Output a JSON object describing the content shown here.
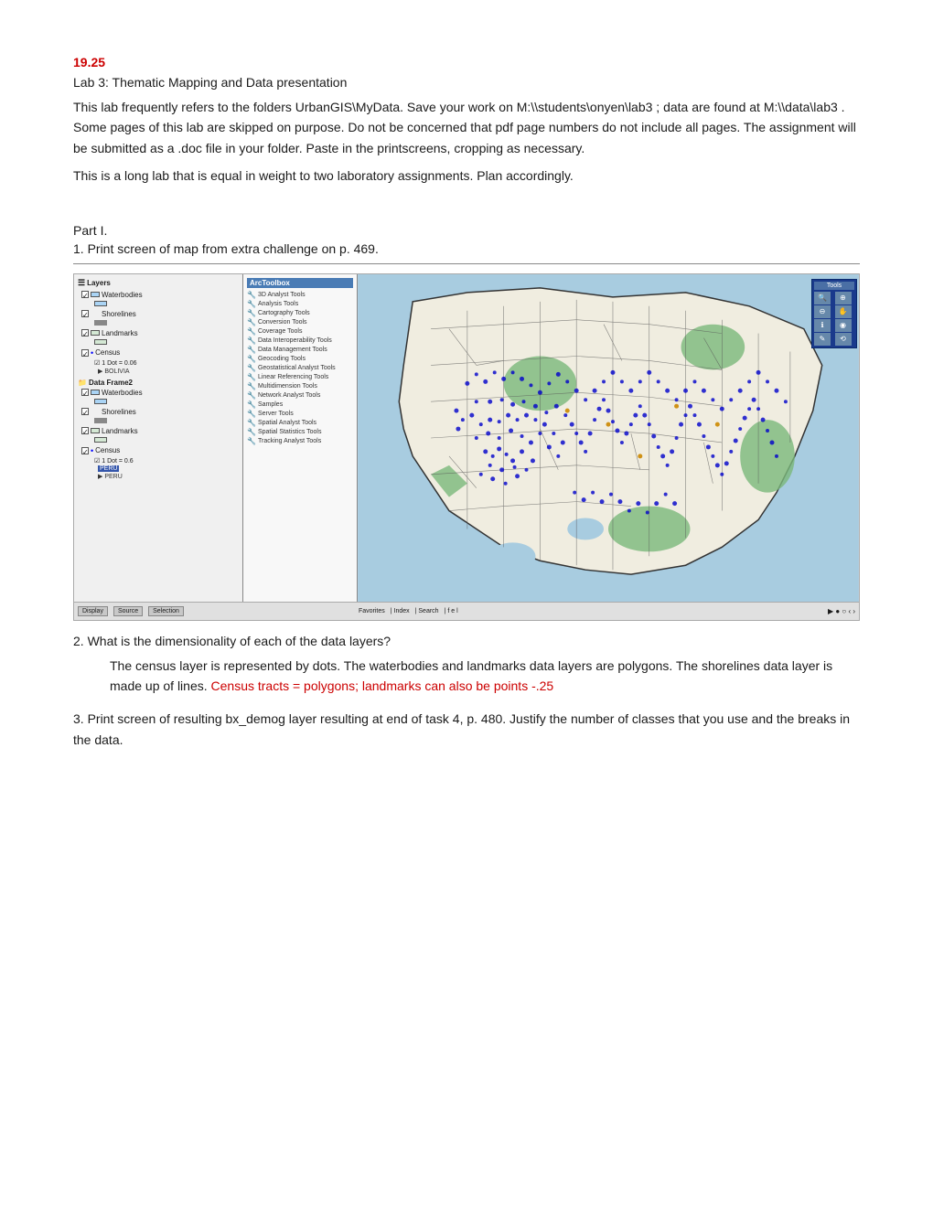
{
  "page": {
    "number": "19.25",
    "lab_title": "Lab 3: Thematic Mapping and Data presentation",
    "intro_paragraphs": [
      "This lab frequently refers to the folders UrbanGIS\\MyData. Save your work on M:\\\\students\\onyen\\lab3 ; data are found at M:\\\\data\\lab3 . Some pages of this lab are skipped on purpose. Do not be concerned that pdf page numbers do not include all pages. The assignment will be submitted as a .doc file in your folder. Paste in the printscreens, cropping as necessary.",
      "This is a long lab that is equal in weight to two laboratory assignments. Plan accordingly."
    ],
    "part_i": {
      "label": "Part I.",
      "question_1": {
        "label": "1. Print screen of map from extra challenge on p. 469."
      },
      "question_2": {
        "label": "2. What is the dimensionality of each of the data layers?",
        "answer_plain": "The census layer is represented by dots. The waterbodies and landmarks data layers are polygons. The shorelines data layer is made up of lines.",
        "answer_red": "Census tracts = polygons; landmarks can also be points  -.25"
      },
      "question_3": {
        "label": "3. Print screen of resulting bx_demog layer resulting at end of task 4, p. 480. Justify the number of classes that you use and the breaks in the data."
      }
    },
    "gis_screenshot": {
      "left_panel": {
        "header": "Layers",
        "items": [
          {
            "name": "Waterbodies",
            "checked": true,
            "type": "polygon"
          },
          {
            "name": "Shorelines",
            "checked": true,
            "type": "line"
          },
          {
            "name": "Landmarks",
            "checked": true,
            "type": "polygon"
          },
          {
            "name": "Census",
            "checked": true,
            "type": "dot",
            "note": "1 Dot = 0.06",
            "sublabel": "BOLIVIA"
          }
        ],
        "dataframe2": {
          "label": "Data Frame2",
          "items": [
            {
              "name": "Waterbodies",
              "checked": true,
              "type": "polygon"
            },
            {
              "name": "Shorelines",
              "checked": true,
              "type": "line"
            },
            {
              "name": "Landmarks",
              "checked": true,
              "type": "polygon"
            },
            {
              "name": "Census",
              "checked": true,
              "type": "dot",
              "note": "1 Dot = 0.6",
              "sublabel": "PERU"
            }
          ]
        }
      },
      "middle_panel": {
        "header": "ArcToolbox",
        "tools": [
          "3D Analyst Tools",
          "Analysis Tools",
          "Cartography Tools",
          "Conversion Tools",
          "Coverage Tools",
          "Data Interoperability Tools",
          "Data Management Tools",
          "Geocoding Tools",
          "Geostatistical Analyst Tools",
          "Linear Referencing Tools",
          "Multidimension Tools",
          "Network Analyst Tools",
          "Samples",
          "Server Tools",
          "Spatial Analyst Tools",
          "Spatial Statistics Tools",
          "Tracking Analyst Tools"
        ]
      },
      "bottom_tabs": [
        "Display",
        "Source",
        "Selection",
        "Favorites",
        "Index",
        "Search",
        "f e l"
      ],
      "tools_right": {
        "buttons": [
          "zoom_in",
          "zoom_out",
          "pan",
          "identify",
          "select",
          "clear"
        ]
      }
    }
  }
}
